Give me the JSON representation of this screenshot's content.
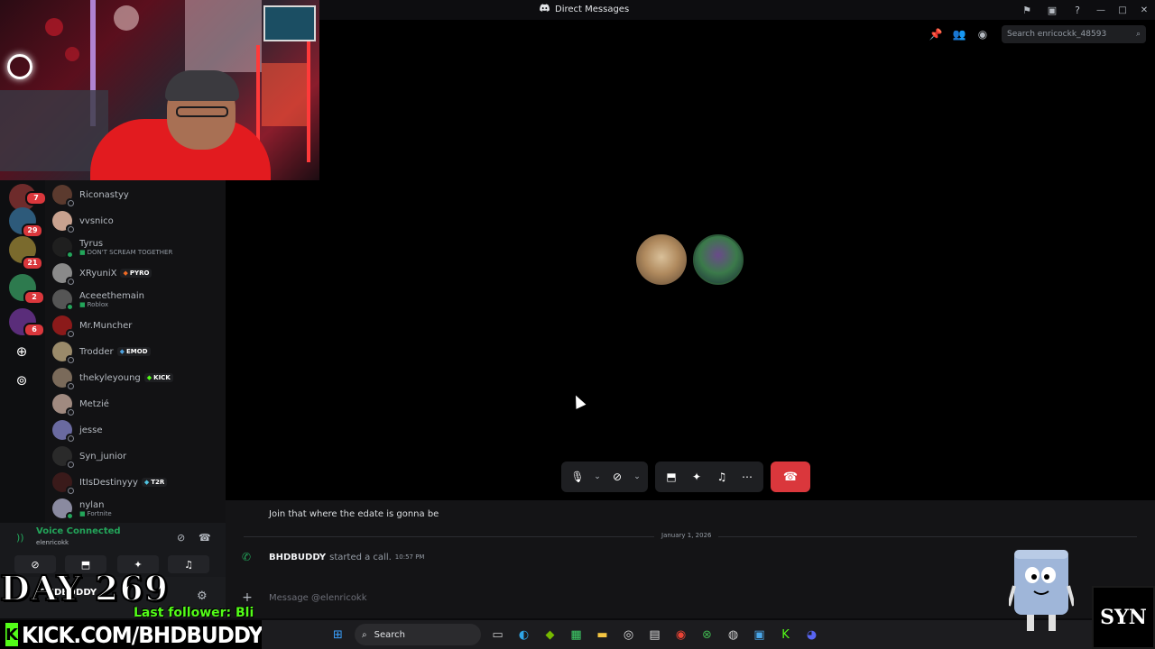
{
  "window": {
    "title": "Direct Messages",
    "icons": [
      "inbox-flag-icon",
      "inbox-icon",
      "help-icon"
    ],
    "controls": [
      "—",
      "□",
      "✕"
    ]
  },
  "header": {
    "search_placeholder": "Search enricockk_48593",
    "icons": [
      "pin-icon",
      "add-friend-icon",
      "profile-icon"
    ]
  },
  "servers": [
    {
      "badge": "7",
      "color": "#6e2b2b"
    },
    {
      "badge": "29",
      "color": "#2d5a7a"
    },
    {
      "badge": "21",
      "color": "#7a6a2d"
    },
    {
      "badge": "2",
      "color": "#2d7a4e"
    },
    {
      "badge": "6",
      "color": "#5a2d7a"
    }
  ],
  "dms": [
    {
      "name": "Riconastyy",
      "sub": "",
      "tag": "",
      "status": "idle",
      "color": "#5b3a2e"
    },
    {
      "name": "vvsnico",
      "sub": "",
      "tag": "",
      "status": "idle",
      "color": "#c9a28f"
    },
    {
      "name": "Tyrus",
      "sub": "DON'T SCREAM TOGETHER",
      "tag": "",
      "status": "on",
      "color": "#1f1f1f"
    },
    {
      "name": "XRyuniX",
      "sub": "",
      "tag": "PYRO",
      "tag_color": "#f06a24",
      "status": "idle",
      "color": "#8a8a8a"
    },
    {
      "name": "Aceeethemain",
      "sub": "Roblox",
      "tag": "",
      "status": "on",
      "color": "#555"
    },
    {
      "name": "Mr.Muncher",
      "sub": "",
      "tag": "",
      "status": "idle",
      "color": "#8b1a1a"
    },
    {
      "name": "Trodder",
      "sub": "",
      "tag": "EMOD",
      "tag_color": "#4fa3e0",
      "status": "idle",
      "color": "#9a8a6a"
    },
    {
      "name": "thekyleyoung",
      "sub": "",
      "tag": "KICK",
      "tag_color": "#53fc18",
      "status": "idle",
      "color": "#7a6a5a"
    },
    {
      "name": "Metzié",
      "sub": "",
      "tag": "",
      "status": "idle",
      "color": "#a08a80"
    },
    {
      "name": "jesse",
      "sub": "",
      "tag": "",
      "status": "idle",
      "color": "#6a6aa0"
    },
    {
      "name": "Syn_junior",
      "sub": "",
      "tag": "",
      "status": "idle",
      "color": "#2a2a2a"
    },
    {
      "name": "ItIsDestinyyy",
      "sub": "",
      "tag": "T2R",
      "tag_color": "#4fc3e0",
      "status": "idle",
      "color": "#3a1a1a"
    },
    {
      "name": "nylan",
      "sub": "Fortnite",
      "tag": "",
      "status": "on",
      "color": "#8a8aa0"
    }
  ],
  "voice": {
    "status": "Voice Connected",
    "channel": "elenricokk",
    "buttons": [
      "video-off-icon",
      "screen-share-icon",
      "activities-icon",
      "soundboard-icon"
    ]
  },
  "user": {
    "name": "BHDBUDDY"
  },
  "overlay": {
    "day": "DAY 269",
    "follower": "Last follower: Bli",
    "kick": "KICK.COM/BHDBUDDY",
    "syn": "SYN"
  },
  "call": {
    "avatars": [
      {
        "name": "dog-avatar",
        "color": "#b89a6e"
      },
      {
        "name": "frog-avatar",
        "color": "#3b7a4a"
      }
    ]
  },
  "chat": {
    "message": "Join that where the edate is gonna be",
    "date": "January 1, 2026",
    "call_user": "BHDBUDDY",
    "call_action": "started a call.",
    "call_time": "10:57 PM",
    "input_placeholder": "Message @elenricokk"
  },
  "taskbar": {
    "search": "Search",
    "apps": [
      "windows-start-icon",
      "task-view-icon",
      "edge-icon",
      "nvidia-icon",
      "game-icon",
      "file-explorer-icon",
      "steam-icon",
      "store-icon",
      "chrome-icon",
      "xbox-icon",
      "obs-icon",
      "app-icon",
      "kick-icon",
      "discord-icon"
    ]
  }
}
